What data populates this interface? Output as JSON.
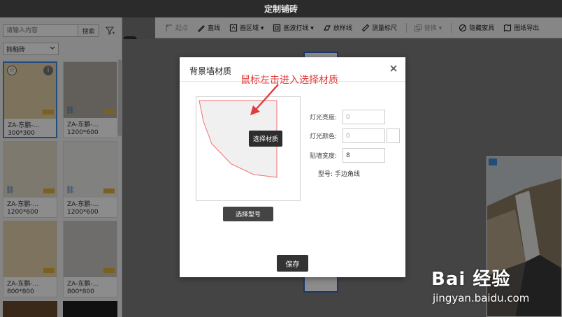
{
  "app": {
    "title": "定制铺砖"
  },
  "sidebar": {
    "search_placeholder": "请输入内容",
    "search_button": "搜索",
    "category_select": "抛釉砖",
    "tiles": [
      {
        "name": "ZA-东鹏-...",
        "size": "300*300",
        "color": "#e3cfa7"
      },
      {
        "name": "ZA-东鹏-...",
        "size": "1200*600",
        "color": "#b2aca4"
      },
      {
        "name": "ZA-东鹏-...",
        "size": "1200*600",
        "color": "#e6dccb"
      },
      {
        "name": "ZA-东鹏-...",
        "size": "1200*600",
        "color": "#ecebea"
      },
      {
        "name": "ZA-东鹏-...",
        "size": "800*800",
        "color": "#e5d1ab"
      },
      {
        "name": "ZA-东鹏-...",
        "size": "800*800",
        "color": "#c8c6c4"
      }
    ]
  },
  "toolbar": {
    "items": [
      {
        "label": "起点",
        "icon": "start-point-icon",
        "disabled": true
      },
      {
        "label": "直线",
        "icon": "pencil-icon"
      },
      {
        "label": "画区域 ▾",
        "icon": "area-icon"
      },
      {
        "label": "画波打线 ▾",
        "icon": "border-line-icon"
      },
      {
        "label": "放样线",
        "icon": "loft-line-icon"
      },
      {
        "label": "测量标尺",
        "icon": "ruler-icon"
      },
      {
        "label": "替换 ▾",
        "icon": "replace-icon",
        "disabled": true
      },
      {
        "label": "隐藏家具",
        "icon": "hide-icon"
      },
      {
        "label": "图纸导出",
        "icon": "export-icon"
      }
    ]
  },
  "dialog": {
    "title": "背景墙材质",
    "annotation": "鼠标左击进入选择材质",
    "tooltip": "选择材质",
    "select_model_button": "选择型号",
    "save_button": "保存",
    "fields": {
      "light_brightness_label": "灯光亮度:",
      "light_brightness_value": "0",
      "light_color_label": "灯光颜色:",
      "light_color_value": "0",
      "edge_width_label": "贴墙宽度:",
      "edge_width_value": "8"
    },
    "model_text": "型号: 手边角线"
  },
  "watermark": {
    "logo": "Bai 经验",
    "url": "jingyan.baidu.com"
  },
  "colors": {
    "accent": "#3c8de0",
    "annotation": "#e23b3b",
    "toolbar_bg": "#f4f4f4"
  }
}
